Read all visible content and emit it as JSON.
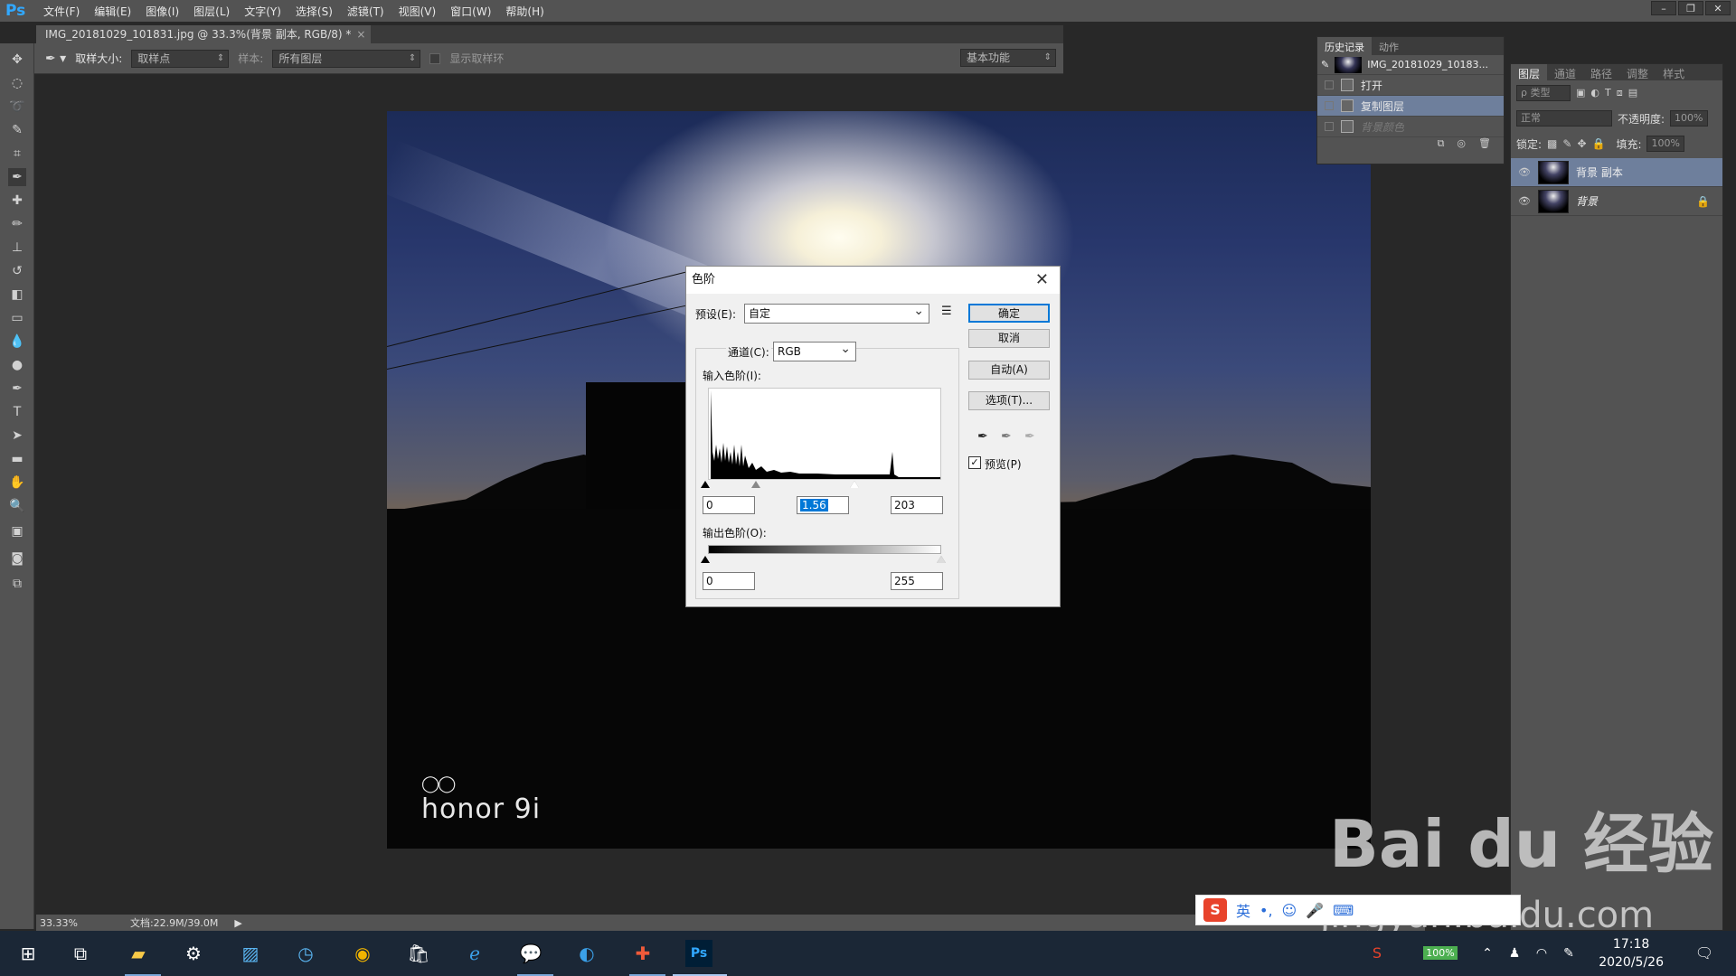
{
  "app": {
    "logo": "Ps"
  },
  "menus": [
    "文件(F)",
    "编辑(E)",
    "图像(I)",
    "图层(L)",
    "文字(Y)",
    "选择(S)",
    "滤镜(T)",
    "视图(V)",
    "窗口(W)",
    "帮助(H)"
  ],
  "window_controls": [
    "–",
    "❐",
    "✕"
  ],
  "document_tab": {
    "title": "IMG_20181029_101831.jpg @ 33.3%(背景 副本, RGB/8) *",
    "close": "×"
  },
  "options_bar": {
    "sample_size_label": "取样大小:",
    "sample_size_value": "取样点",
    "sample_label": "样本:",
    "sample_value": "所有图层",
    "show_ring_label": "显示取样环",
    "workspace": "基本功能"
  },
  "photo": {
    "brand": "honor 9i",
    "brand_rings": "◯◯"
  },
  "status": {
    "zoom": "33.33%",
    "doc": "文档:22.9M/39.0M"
  },
  "history_panel": {
    "tabs": [
      "历史记录",
      "动作"
    ],
    "snapshot": "IMG_20181029_10183...",
    "items": [
      {
        "label": "打开",
        "state": "normal"
      },
      {
        "label": "复制图层",
        "state": "selected"
      },
      {
        "label": "背景颜色",
        "state": "dim"
      }
    ]
  },
  "layers_panel": {
    "tabs": [
      "图层",
      "通道",
      "路径",
      "调整",
      "样式"
    ],
    "filter_label": "ρ 类型",
    "blend_mode": "正常",
    "opacity_label": "不透明度:",
    "opacity_value": "100%",
    "lock_label": "锁定:",
    "fill_label": "填充:",
    "fill_value": "100%",
    "layers": [
      {
        "name": "背景 副本",
        "selected": true
      },
      {
        "name": "背景",
        "selected": false
      }
    ]
  },
  "levels_dialog": {
    "title": "色阶",
    "preset_label": "预设(E):",
    "preset_value": "自定",
    "channel_label": "通道(C):",
    "channel_value": "RGB",
    "input_label": "输入色阶(I):",
    "input_black": "0",
    "input_gamma": "1.56",
    "input_white": "203",
    "output_label": "输出色阶(O):",
    "output_black": "0",
    "output_white": "255",
    "buttons": {
      "ok": "确定",
      "cancel": "取消",
      "auto": "自动(A)",
      "options": "选项(T)..."
    },
    "preview_label": "预览(P)",
    "preview_checked": true,
    "input_slider_levels": {
      "black": 0,
      "gamma": 1.56,
      "white": 203
    }
  },
  "ime_bar": {
    "logo": "S",
    "mode": "英"
  },
  "watermark": {
    "text": "Bai du 经验",
    "url": "jingyan.baidu.com"
  },
  "taskbar": {
    "battery": "100%",
    "time": "17:18",
    "date": "2020/5/26"
  },
  "colors": {
    "accent": "#0078d7",
    "selection": "#6e7f9c",
    "ps_blue": "#31a8ff"
  }
}
